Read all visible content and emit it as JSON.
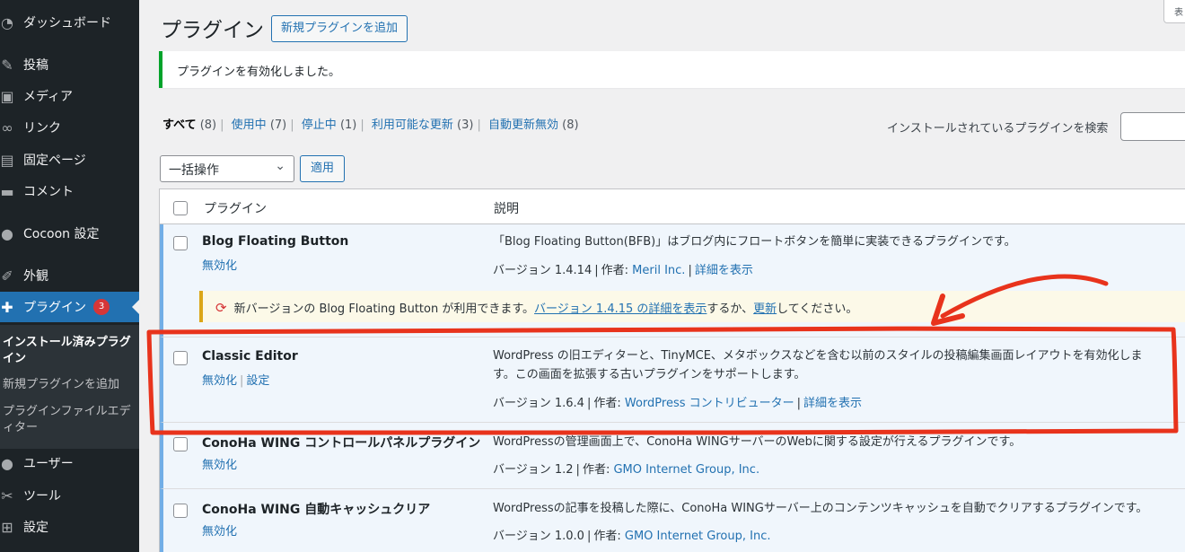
{
  "sidebar": {
    "items": [
      {
        "label": "ダッシュボード",
        "icon": "dashboard-icon",
        "glyph": "◔"
      },
      {
        "label": "投稿",
        "icon": "pin-icon",
        "glyph": "✎"
      },
      {
        "label": "メディア",
        "icon": "media-icon",
        "glyph": "▣"
      },
      {
        "label": "リンク",
        "icon": "link-icon",
        "glyph": "∞"
      },
      {
        "label": "固定ページ",
        "icon": "page-icon",
        "glyph": "▤"
      },
      {
        "label": "コメント",
        "icon": "comment-icon",
        "glyph": "▬"
      },
      {
        "label": "Cocoon 設定",
        "icon": "cocoon-icon",
        "glyph": "●"
      },
      {
        "label": "外観",
        "icon": "appearance-icon",
        "glyph": "✐"
      },
      {
        "label": "プラグイン",
        "icon": "plugin-icon",
        "glyph": "✚",
        "badge": "3"
      },
      {
        "label": "ユーザー",
        "icon": "user-icon",
        "glyph": "●"
      },
      {
        "label": "ツール",
        "icon": "tool-icon",
        "glyph": "✂"
      },
      {
        "label": "設定",
        "icon": "settings-icon",
        "glyph": "⊞"
      }
    ],
    "submenu": [
      {
        "label": "インストール済みプラグイン"
      },
      {
        "label": "新規プラグインを追加"
      },
      {
        "label": "プラグインファイルエディター"
      }
    ]
  },
  "header": {
    "title": "プラグイン",
    "add_new": "新規プラグインを追加",
    "screen_options": "表"
  },
  "notice": "プラグインを有効化しました。",
  "filters": [
    {
      "label": "すべて",
      "count": "(8)"
    },
    {
      "label": "使用中",
      "count": "(7)"
    },
    {
      "label": "停止中",
      "count": "(1)"
    },
    {
      "label": "利用可能な更新",
      "count": "(3)"
    },
    {
      "label": "自動更新無効",
      "count": "(8)"
    }
  ],
  "search": {
    "label": "インストールされているプラグインを検索"
  },
  "bulk": {
    "selected": "一括操作",
    "apply": "適用"
  },
  "table": {
    "col_plugin": "プラグイン",
    "col_desc": "説明",
    "plugins": [
      {
        "name": "Blog Floating Button",
        "actions": [
          "無効化"
        ],
        "desc": "「Blog Floating Button(BFB)」はブログ内にフロートボタンを簡単に実装できるプラグインです。",
        "version": "バージョン 1.4.14",
        "author_prefix": "作者:",
        "author": "Meril Inc.",
        "details": "詳細を表示"
      },
      {
        "name": "Classic Editor",
        "actions": [
          "無効化",
          "設定"
        ],
        "desc": "WordPress の旧エディターと、TinyMCE、メタボックスなどを含む以前のスタイルの投稿編集画面レイアウトを有効化します。この画面を拡張する古いプラグインをサポートします。",
        "version": "バージョン 1.6.4",
        "author_prefix": "作者:",
        "author": "WordPress コントリビューター",
        "details": "詳細を表示"
      },
      {
        "name": "ConoHa WING コントロールパネルプラグイン",
        "actions": [
          "無効化"
        ],
        "desc": "WordPressの管理画面上で、ConoHa WINGサーバーのWebに関する設定が行えるプラグインです。",
        "version": "バージョン 1.2",
        "author_prefix": "作者:",
        "author": "GMO Internet Group, Inc."
      },
      {
        "name": "ConoHa WING 自動キャッシュクリア",
        "actions": [
          "無効化"
        ],
        "desc": "WordPressの記事を投稿した際に、ConoHa WINGサーバー上のコンテンツキャッシュを自動でクリアするプラグインです。",
        "version": "バージョン 1.0.0",
        "author_prefix": "作者:",
        "author": "GMO Internet Group, Inc."
      }
    ],
    "update": {
      "pre": "新バージョンの Blog Floating Button が利用できます。",
      "link1": "バージョン 1.4.15 の詳細を表示",
      "mid": "するか、",
      "link2": "更新",
      "post": "してください。"
    }
  },
  "colors": {
    "sidebar_bg": "#1d2327",
    "accent": "#2271b1",
    "success": "#00a32a",
    "warning": "#dba617",
    "annotation": "#e8331c"
  }
}
